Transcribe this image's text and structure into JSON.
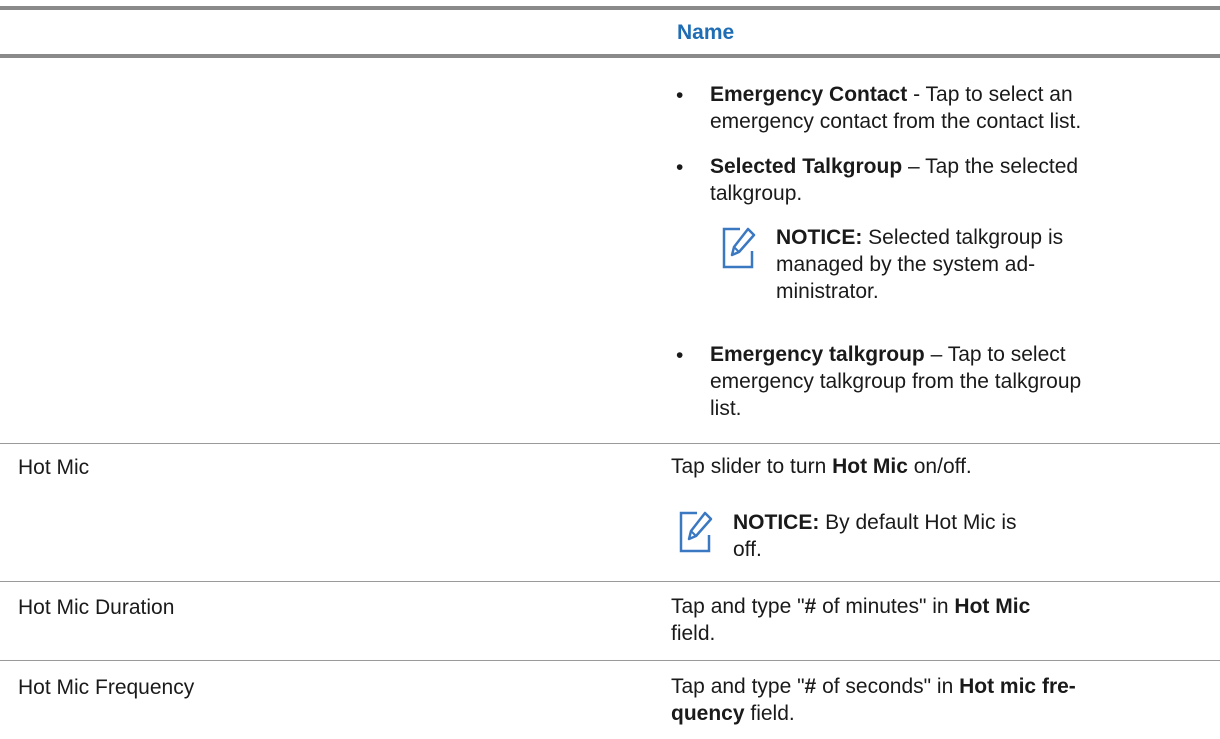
{
  "table": {
    "header": {
      "col2": "Name"
    },
    "row1": {
      "bullets": [
        {
          "term": "Emergency Contact",
          "sep": " - ",
          "line1_rest": "Tap to select an",
          "line2": "emergency contact from the contact list."
        },
        {
          "term": "Selected Talkgroup",
          "sep": " – ",
          "line1_rest": "Tap the selected",
          "line2": "talkgroup."
        },
        {
          "term": "Emergency talkgroup",
          "sep": " – ",
          "line1_rest": "Tap to select",
          "line2": "emergency talkgroup from the talkgroup",
          "line3": "list."
        }
      ],
      "notice": {
        "label": "NOTICE:",
        "line1_rest": " Selected talkgroup is",
        "line2": "managed by the system ad-",
        "line3": "ministrator."
      }
    },
    "row2": {
      "name": "Hot Mic",
      "desc": {
        "pre": "Tap slider to turn ",
        "bold": "Hot Mic",
        "post": " on/off."
      },
      "notice": {
        "label": "NOTICE:",
        "line1_rest": " By default Hot Mic is",
        "line2": "off."
      }
    },
    "row3": {
      "name": "Hot Mic Duration",
      "desc": {
        "pre": "Tap and type \"",
        "bold1": "#",
        "mid": " of minutes\" in ",
        "bold2": "Hot Mic",
        "line2": "field."
      }
    },
    "row4": {
      "name": "Hot Mic Frequency",
      "desc": {
        "pre": "Tap and type \"",
        "bold1": "#",
        "mid": " of seconds\" in ",
        "bold2": "Hot mic fre-",
        "line2_bold": "quency",
        "line2_rest": " field."
      }
    }
  },
  "icons": {
    "notice": "notice-pencil-icon"
  },
  "colors": {
    "header": "#1f6db5",
    "icon": "#3a78c2",
    "rules": "#8a8a8a"
  }
}
